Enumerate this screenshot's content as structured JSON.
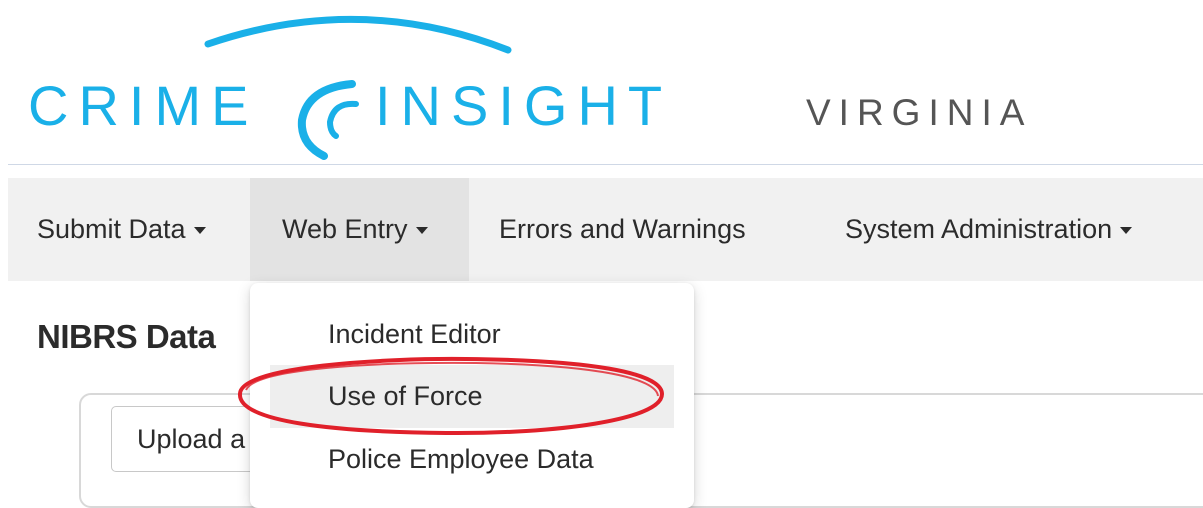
{
  "logo": {
    "word_left": "CRIME",
    "word_right": "INSIGHT",
    "state": "VIRGINIA",
    "brand_color": "#1ab0e8",
    "state_color": "#555555"
  },
  "navbar": {
    "items": [
      {
        "label": "Submit Data",
        "has_dropdown": true,
        "active": false
      },
      {
        "label": "Web Entry",
        "has_dropdown": true,
        "active": true
      },
      {
        "label": "Errors and Warnings",
        "has_dropdown": false,
        "active": false
      },
      {
        "label": "System Administration",
        "has_dropdown": true,
        "active": false
      }
    ]
  },
  "main": {
    "heading": "NIBRS Data",
    "upload_button_label": "Upload a"
  },
  "dropdown": {
    "items": [
      {
        "label": "Incident Editor",
        "highlighted": false
      },
      {
        "label": "Use of Force",
        "highlighted": true
      },
      {
        "label": "Police Employee Data",
        "highlighted": false
      }
    ]
  },
  "annotation": {
    "type": "ellipse",
    "color": "#e0202a",
    "target": "Use of Force"
  }
}
